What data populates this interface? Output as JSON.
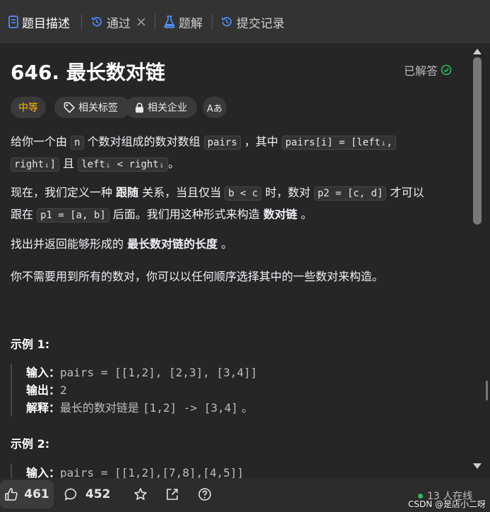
{
  "tabs": [
    {
      "label": "题目描述",
      "icon": "description-icon",
      "active": true
    },
    {
      "label": "通过",
      "icon": "history-icon",
      "active": false,
      "closable": true
    },
    {
      "label": "题解",
      "icon": "flask-icon",
      "active": false
    },
    {
      "label": "提交记录",
      "icon": "history-icon",
      "active": false
    }
  ],
  "problem": {
    "title": "646. 最长数对链",
    "status": "已解答",
    "tags": {
      "difficulty": "中等",
      "related_tags": "相关标签",
      "related_companies": "相关企业",
      "translate": "Aあ"
    }
  },
  "description": {
    "p1": {
      "t1": "给你一个由",
      "c1": "n",
      "t2": "个数对组成的数对数组",
      "c2": "pairs",
      "t3": "，其中",
      "c3": "pairs[i] = [leftᵢ,",
      "c4": "rightᵢ]",
      "t4": "且",
      "c5": "leftᵢ < rightᵢ",
      "t5": "。"
    },
    "p2": {
      "t1": "现在，我们定义一种",
      "b1": "跟随",
      "t2": "关系，当且仅当",
      "c1": "b < c",
      "t3": "时，数对",
      "c2": "p2 = [c, d]",
      "t4": "才可以",
      "t5": "跟在",
      "c3": "p1 = [a, b]",
      "t6": "后面。我们用这种形式来构造",
      "b2": "数对链",
      "t7": "。"
    },
    "p3": {
      "t1": "找出并返回能够形成的",
      "b1": "最长数对链的长度",
      "t2": "。"
    },
    "p4": "你不需要用到所有的数对，你可以以任何顺序选择其中的一些数对来构造。"
  },
  "examples": [
    {
      "heading": "示例 1:",
      "input_label": "输入：",
      "input": "pairs = [[1,2], [2,3], [3,4]]",
      "output_label": "输出：",
      "output": "2",
      "explain_label": "解释：",
      "explain_text": "最长的数对链是",
      "explain_code": "[1,2] -> [3,4]",
      "explain_end": "。"
    },
    {
      "heading": "示例 2:",
      "input_label": "输入：",
      "input": "pairs = [[1,2],[7,8],[4,5]]"
    }
  ],
  "bottom": {
    "likes": "461",
    "comments": "452",
    "online": "13 人在线"
  },
  "watermark": "CSDN @是店小二呀",
  "colors": {
    "accent_green": "#2cbb5d",
    "difficulty_yellow": "#ffb800",
    "active_tab_icon": "#4e8ff6"
  }
}
